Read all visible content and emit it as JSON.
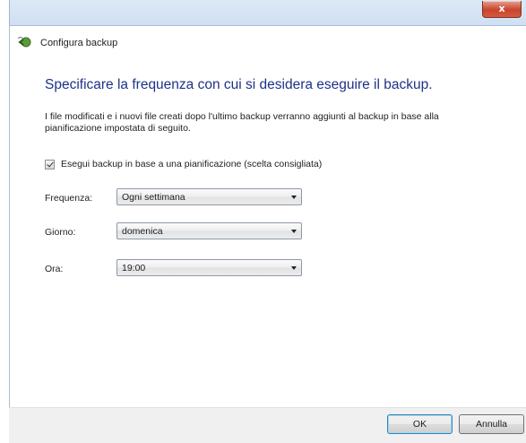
{
  "window": {
    "close_label": "x",
    "title": "Configura backup",
    "back_icon": "back-arrow-icon"
  },
  "main": {
    "heading": "Specificare la frequenza con cui si desidera eseguire il backup.",
    "description": "I file modificati e i nuovi file creati dopo l'ultimo backup verranno aggiunti al backup in base alla pianificazione impostata di seguito.",
    "schedule_checkbox": {
      "label": "Esegui backup in base a una pianificazione (scelta consigliata)",
      "checked": true
    },
    "frequency": {
      "label": "Frequenza:",
      "value": "Ogni settimana"
    },
    "day": {
      "label": "Giorno:",
      "value": "domenica"
    },
    "time": {
      "label": "Ora:",
      "value": "19:00"
    }
  },
  "footer": {
    "ok_label": "OK",
    "cancel_label": "Annulla"
  },
  "colors": {
    "heading": "#1e3287",
    "frame": "#c9dcf0",
    "close_button": "#c8452c"
  }
}
